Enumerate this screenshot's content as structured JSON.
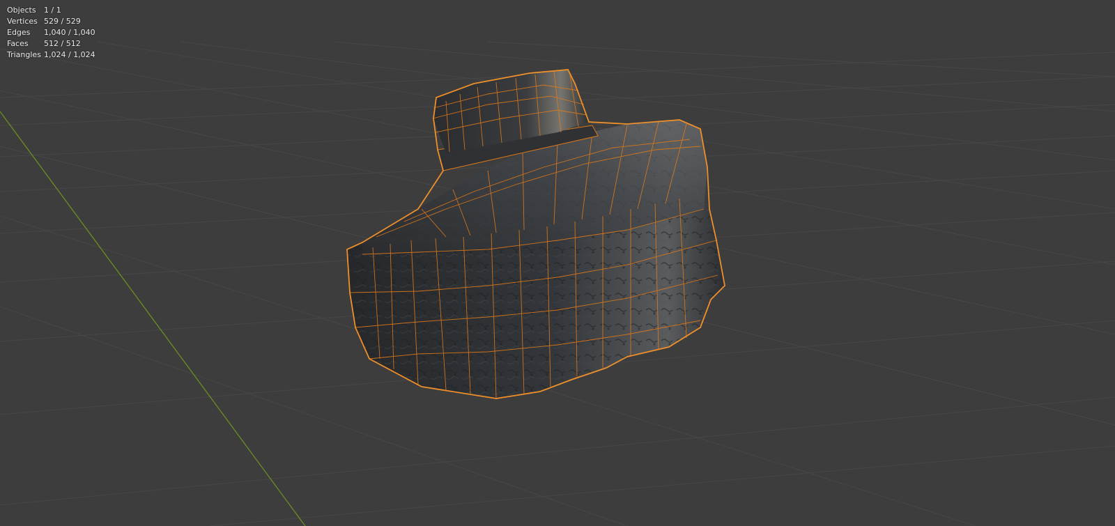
{
  "stats": [
    {
      "label": "Objects",
      "value": "1 / 1"
    },
    {
      "label": "Vertices",
      "value": "529 / 529"
    },
    {
      "label": "Edges",
      "value": "1,040 / 1,040"
    },
    {
      "label": "Faces",
      "value": "512 / 512"
    },
    {
      "label": "Triangles",
      "value": "1,024 / 1,024"
    }
  ],
  "colors": {
    "background": "#3d3d3d",
    "grid": "#4a4a4a",
    "y_axis": "#6b8e23",
    "selection_outline": "#f0902a",
    "wireframe": "#e07a18",
    "mesh": "#2e3033"
  }
}
